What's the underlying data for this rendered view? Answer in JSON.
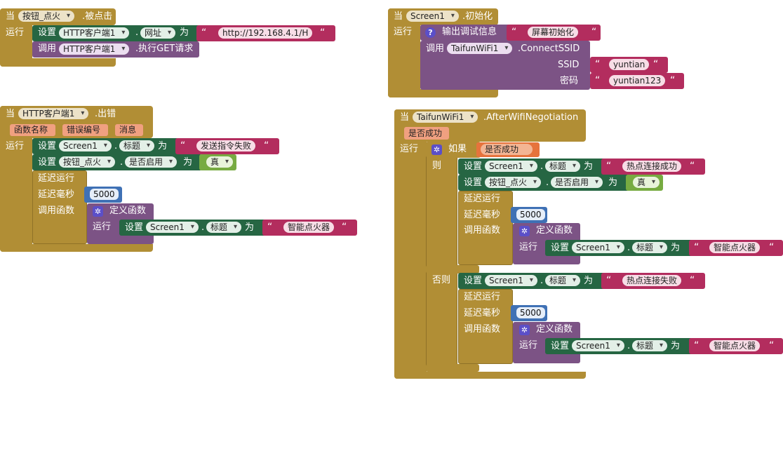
{
  "kw": {
    "when": "当",
    "do": "运行",
    "set": "设置",
    "call": "调用",
    "to": "为",
    "if": "如果",
    "then": "则",
    "else": "否则",
    "delay": "延迟运行",
    "delay_ms": "延迟毫秒",
    "call_func": "调用函数",
    "def_func": "定义函数",
    "quote": "“",
    "dot": "."
  },
  "block_click": {
    "component": "按钮_点火",
    "event": ".被点击",
    "set_component": "HTTP客户端1",
    "set_property": "网址",
    "url": "http://192.168.4.1/H",
    "call_component": "HTTP客户端1",
    "call_method": ".执行GET请求"
  },
  "block_init": {
    "component": "Screen1",
    "event": ".初始化",
    "debug_label": "输出调试信息",
    "debug_text": "屏幕初始化",
    "call_component": "TaifunWiFi1",
    "call_method": ".ConnectSSID",
    "ssid_label": "SSID",
    "ssid_value": "yuntian",
    "pwd_label": "密码",
    "pwd_value": "yuntian123"
  },
  "block_error": {
    "component": "HTTP客户端1",
    "event": ".出错",
    "params": [
      "函数名称",
      "错误编号",
      "消息"
    ],
    "set1_component": "Screen1",
    "set1_property": "标题",
    "set1_text": "发送指令失败",
    "set2_component": "按钮_点火",
    "set2_property": "是否启用",
    "set2_value": "真",
    "delay_value": "5000",
    "inner_component": "Screen1",
    "inner_property": "标题",
    "inner_text": "智能点火器"
  },
  "block_wifi": {
    "component": "TaifunWiFi1",
    "event": ".AfterWifiNegotiation",
    "param": "是否成功",
    "cond_var": "是否成功",
    "then_set1_component": "Screen1",
    "then_set1_property": "标题",
    "then_set1_text": "热点连接成功",
    "then_set2_component": "按钮_点火",
    "then_set2_property": "是否启用",
    "then_set2_value": "真",
    "then_delay": "5000",
    "then_inner_component": "Screen1",
    "then_inner_property": "标题",
    "then_inner_text": "智能点火器",
    "else_set_component": "Screen1",
    "else_set_property": "标题",
    "else_set_text": "热点连接失败",
    "else_delay": "5000",
    "else_inner_component": "Screen1",
    "else_inner_property": "标题",
    "else_inner_text": "智能点火器"
  },
  "colors": {
    "event": "#b18e35",
    "setter": "#266643",
    "call": "#7c5385",
    "text": "#b32d5e",
    "number": "#3f71b5",
    "logic": "#77ab41",
    "param": "#f0a080"
  }
}
